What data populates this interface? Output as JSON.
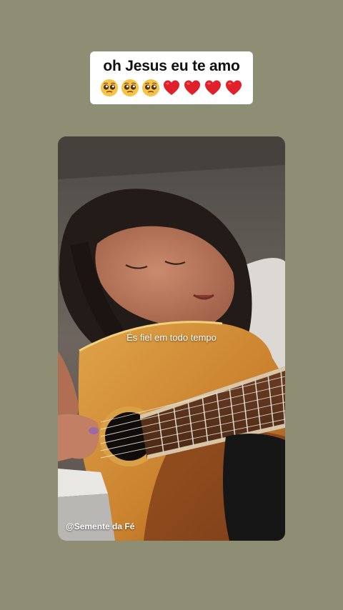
{
  "story": {
    "caption_text": "oh Jesus eu te amo",
    "caption_emojis": [
      "pleading-face-emoji",
      "pleading-face-emoji",
      "pleading-face-emoji",
      "red-heart-emoji",
      "red-heart-emoji",
      "red-heart-emoji",
      "red-heart-emoji"
    ],
    "background_color": "#8d8e74"
  },
  "video": {
    "subtitle": "És fiel em todo tempo",
    "watermark": "@Semente da Fé"
  }
}
